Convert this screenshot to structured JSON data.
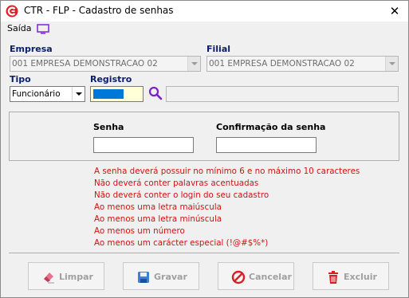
{
  "window": {
    "title": "CTR - FLP - Cadastro de senhas",
    "close_glyph": "✕"
  },
  "menu": {
    "saida_label": "Saída",
    "monitor_icon": "monitor-icon"
  },
  "form": {
    "empresa_label": "Empresa",
    "empresa_value": "001 EMPRESA DEMONSTRACAO 02",
    "filial_label": "Filial",
    "filial_value": "001 EMPRESA DEMONSTRACAO 02",
    "tipo_label": "Tipo",
    "tipo_value": "Funcionário",
    "registro_label": "Registro",
    "registro_value": "",
    "registro_name": ""
  },
  "password_panel": {
    "senha_label": "Senha",
    "confirmacao_label": "Confirmação da senha"
  },
  "rules": [
    "A senha deverá possuir no mínimo 6 e no máximo 10 caracteres",
    "Não deverá conter palavras acentuadas",
    "Não deverá conter o login do seu cadastro",
    "Ao menos uma letra maiúscula",
    "Ao menos uma letra minúscula",
    "Ao menos um número",
    "Ao menos um carácter especial (!@#$%*)"
  ],
  "buttons": {
    "limpar": "Limpar",
    "gravar": "Gravar",
    "cancelar": "Cancelar",
    "excluir": "Excluir"
  },
  "colors": {
    "label_blue": "#0a1e6e",
    "rule_red": "#d01414",
    "selection_blue": "#0078d7",
    "registro_bg": "#ffffd8",
    "accent_purple": "#8a2be2"
  }
}
